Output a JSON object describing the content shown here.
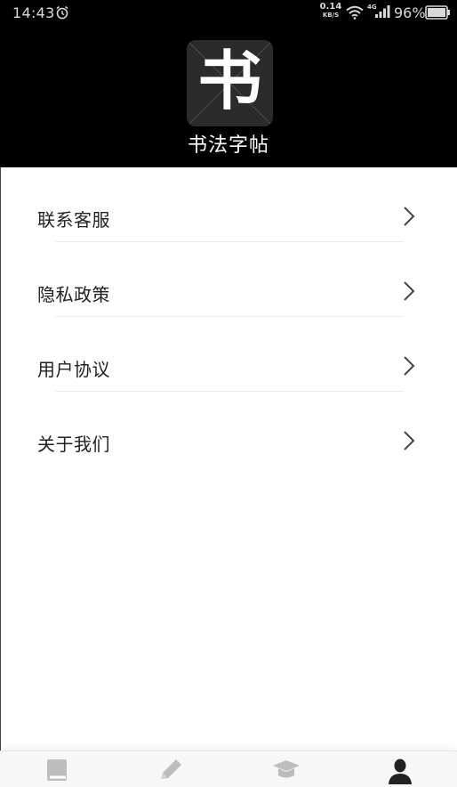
{
  "status_bar": {
    "time": "14:43",
    "net_speed_value": "0.14",
    "net_speed_unit": "KB/S",
    "network_type": "4G",
    "battery": "96%"
  },
  "header": {
    "logo_char": "书",
    "app_name": "书法字帖"
  },
  "menu": {
    "items": [
      {
        "label": "联系客服"
      },
      {
        "label": "隐私政策"
      },
      {
        "label": "用户协议"
      },
      {
        "label": "关于我们"
      }
    ]
  },
  "tab_bar": {
    "tabs": [
      {
        "icon": "book-icon",
        "active": false
      },
      {
        "icon": "pencil-icon",
        "active": false
      },
      {
        "icon": "graduation-cap-icon",
        "active": false
      },
      {
        "icon": "user-icon",
        "active": true
      }
    ],
    "active_color": "#222222",
    "inactive_color": "#bdbdbd"
  }
}
